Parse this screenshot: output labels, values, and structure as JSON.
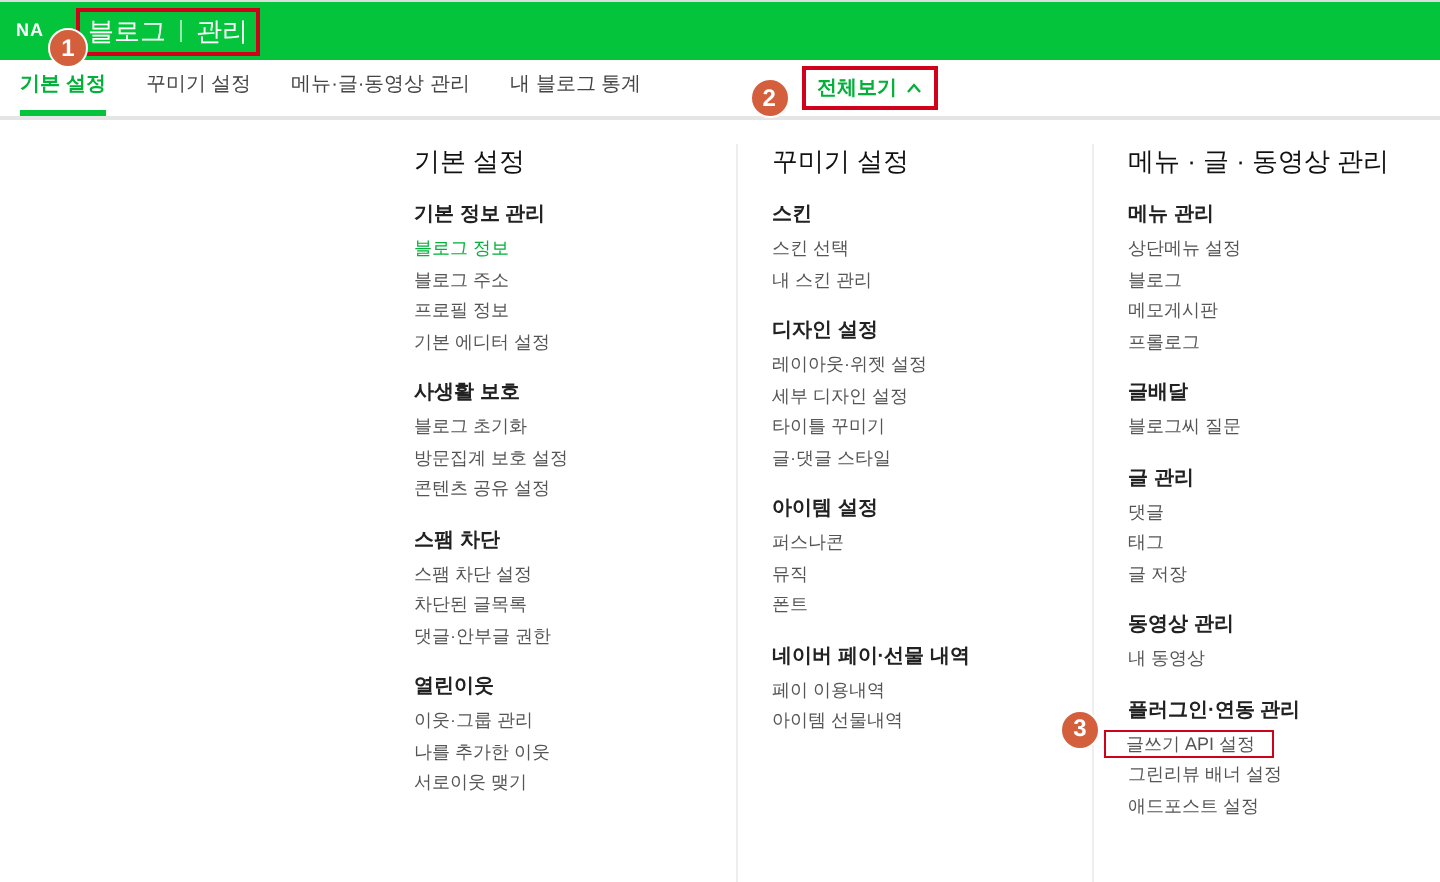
{
  "header": {
    "logo": "NA",
    "title_parts": [
      "블로그",
      "관리"
    ],
    "annotation": {
      "number": "1"
    }
  },
  "tabs": [
    {
      "label": "기본 설정",
      "selected": true
    },
    {
      "label": "꾸미기 설정",
      "selected": false
    },
    {
      "label": "메뉴·글·동영상 관리",
      "selected": false
    },
    {
      "label": "내 블로그 통계",
      "selected": false
    }
  ],
  "view_all": {
    "label": "전체보기",
    "expanded": true,
    "annotation": {
      "number": "2"
    }
  },
  "columns": [
    {
      "title": "기본 설정",
      "sections": [
        {
          "heading": "기본 정보 관리",
          "items": [
            {
              "label": "블로그 정보",
              "selected": true
            },
            {
              "label": "블로그 주소",
              "selected": false
            },
            {
              "label": "프로필 정보",
              "selected": false
            },
            {
              "label": "기본 에디터 설정",
              "selected": false
            }
          ]
        },
        {
          "heading": "사생활 보호",
          "items": [
            {
              "label": "블로그 초기화",
              "selected": false
            },
            {
              "label": "방문집계 보호 설정",
              "selected": false
            },
            {
              "label": "콘텐츠 공유 설정",
              "selected": false
            }
          ]
        },
        {
          "heading": "스팸 차단",
          "items": [
            {
              "label": "스팸 차단 설정",
              "selected": false
            },
            {
              "label": "차단된 글목록",
              "selected": false
            },
            {
              "label": "댓글·안부글 권한",
              "selected": false
            }
          ]
        },
        {
          "heading": "열린이웃",
          "items": [
            {
              "label": "이웃·그룹 관리",
              "selected": false
            },
            {
              "label": "나를 추가한 이웃",
              "selected": false
            },
            {
              "label": "서로이웃 맺기",
              "selected": false
            }
          ]
        }
      ]
    },
    {
      "title": "꾸미기 설정",
      "sections": [
        {
          "heading": "스킨",
          "items": [
            {
              "label": "스킨 선택",
              "selected": false
            },
            {
              "label": "내 스킨 관리",
              "selected": false
            }
          ]
        },
        {
          "heading": "디자인 설정",
          "items": [
            {
              "label": "레이아웃·위젯 설정",
              "selected": false
            },
            {
              "label": "세부 디자인 설정",
              "selected": false
            },
            {
              "label": "타이틀 꾸미기",
              "selected": false
            },
            {
              "label": "글·댓글 스타일",
              "selected": false
            }
          ]
        },
        {
          "heading": "아이템 설정",
          "items": [
            {
              "label": "퍼스나콘",
              "selected": false
            },
            {
              "label": "뮤직",
              "selected": false
            },
            {
              "label": "폰트",
              "selected": false
            }
          ]
        },
        {
          "heading": "네이버 페이·선물 내역",
          "items": [
            {
              "label": "페이 이용내역",
              "selected": false
            },
            {
              "label": "아이템 선물내역",
              "selected": false
            }
          ]
        }
      ]
    },
    {
      "title": "메뉴 · 글 · 동영상 관리",
      "sections": [
        {
          "heading": "메뉴 관리",
          "items": [
            {
              "label": "상단메뉴 설정",
              "selected": false
            },
            {
              "label": "블로그",
              "selected": false
            },
            {
              "label": "메모게시판",
              "selected": false
            },
            {
              "label": "프롤로그",
              "selected": false
            }
          ]
        },
        {
          "heading": "글배달",
          "items": [
            {
              "label": "블로그씨 질문",
              "selected": false
            }
          ]
        },
        {
          "heading": "글 관리",
          "items": [
            {
              "label": "댓글",
              "selected": false
            },
            {
              "label": "태그",
              "selected": false
            },
            {
              "label": "글 저장",
              "selected": false
            }
          ]
        },
        {
          "heading": "동영상 관리",
          "items": [
            {
              "label": "내 동영상",
              "selected": false
            }
          ]
        },
        {
          "heading": "플러그인·연동 관리",
          "items": [
            {
              "label": "글쓰기 API 설정",
              "selected": false,
              "annotation": {
                "number": "3"
              }
            },
            {
              "label": "그린리뷰 배너 설정",
              "selected": false
            },
            {
              "label": "애드포스트 설정",
              "selected": false
            }
          ]
        }
      ]
    }
  ]
}
